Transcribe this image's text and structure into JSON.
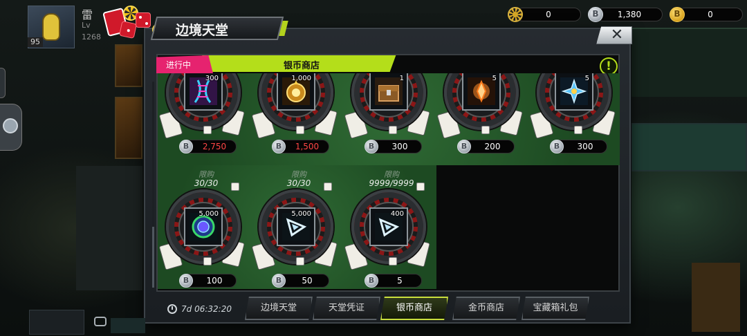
{
  "player": {
    "name": "雷",
    "level_prefix": "Lv",
    "id_partial": "1268",
    "level_badge": "95"
  },
  "currencies": [
    {
      "name": "chip",
      "value": "0",
      "color": "#d4a626"
    },
    {
      "name": "silver",
      "symbol": "B",
      "value": "1,380",
      "color": "#c7ced5"
    },
    {
      "name": "gold",
      "symbol": "B",
      "value": "0",
      "color": "#e0a91f"
    }
  ],
  "window": {
    "title": "边境天堂",
    "close_glyph": "✕"
  },
  "shop": {
    "status": "进行中",
    "title": "银币商店",
    "info_glyph": "!"
  },
  "coin_symbol": "B",
  "items": [
    {
      "name": "dna-helix",
      "qty": "300",
      "price": "2,750",
      "price_color": "red"
    },
    {
      "name": "golden-orb",
      "qty": "1,000",
      "price": "1,500",
      "price_color": "red"
    },
    {
      "name": "chest",
      "qty": "1",
      "price": "300",
      "price_color": "white"
    },
    {
      "name": "flame-shard",
      "qty": "5",
      "price": "200",
      "price_color": "white"
    },
    {
      "name": "blue-shuriken",
      "qty": "5",
      "price": "300",
      "price_color": "white"
    },
    {
      "name": "portal-orb",
      "qty": "5,000",
      "price": "100",
      "price_color": "white",
      "limit_label": "限购",
      "limit": "30/30"
    },
    {
      "name": "crystal-triangle",
      "qty": "5,000",
      "price": "50",
      "price_color": "white",
      "limit_label": "限购",
      "limit": "30/30"
    },
    {
      "name": "crystal-triangle-small",
      "qty": "400",
      "price": "5",
      "price_color": "white",
      "limit_label": "限购",
      "limit": "9999/9999"
    }
  ],
  "timer": "7d 06:32:20",
  "tabs": [
    {
      "label": "边境天堂",
      "active": false
    },
    {
      "label": "天堂凭证",
      "active": false
    },
    {
      "label": "银币商店",
      "active": true
    },
    {
      "label": "金币商店",
      "active": false
    },
    {
      "label": "宝藏箱礼包",
      "active": false
    }
  ]
}
